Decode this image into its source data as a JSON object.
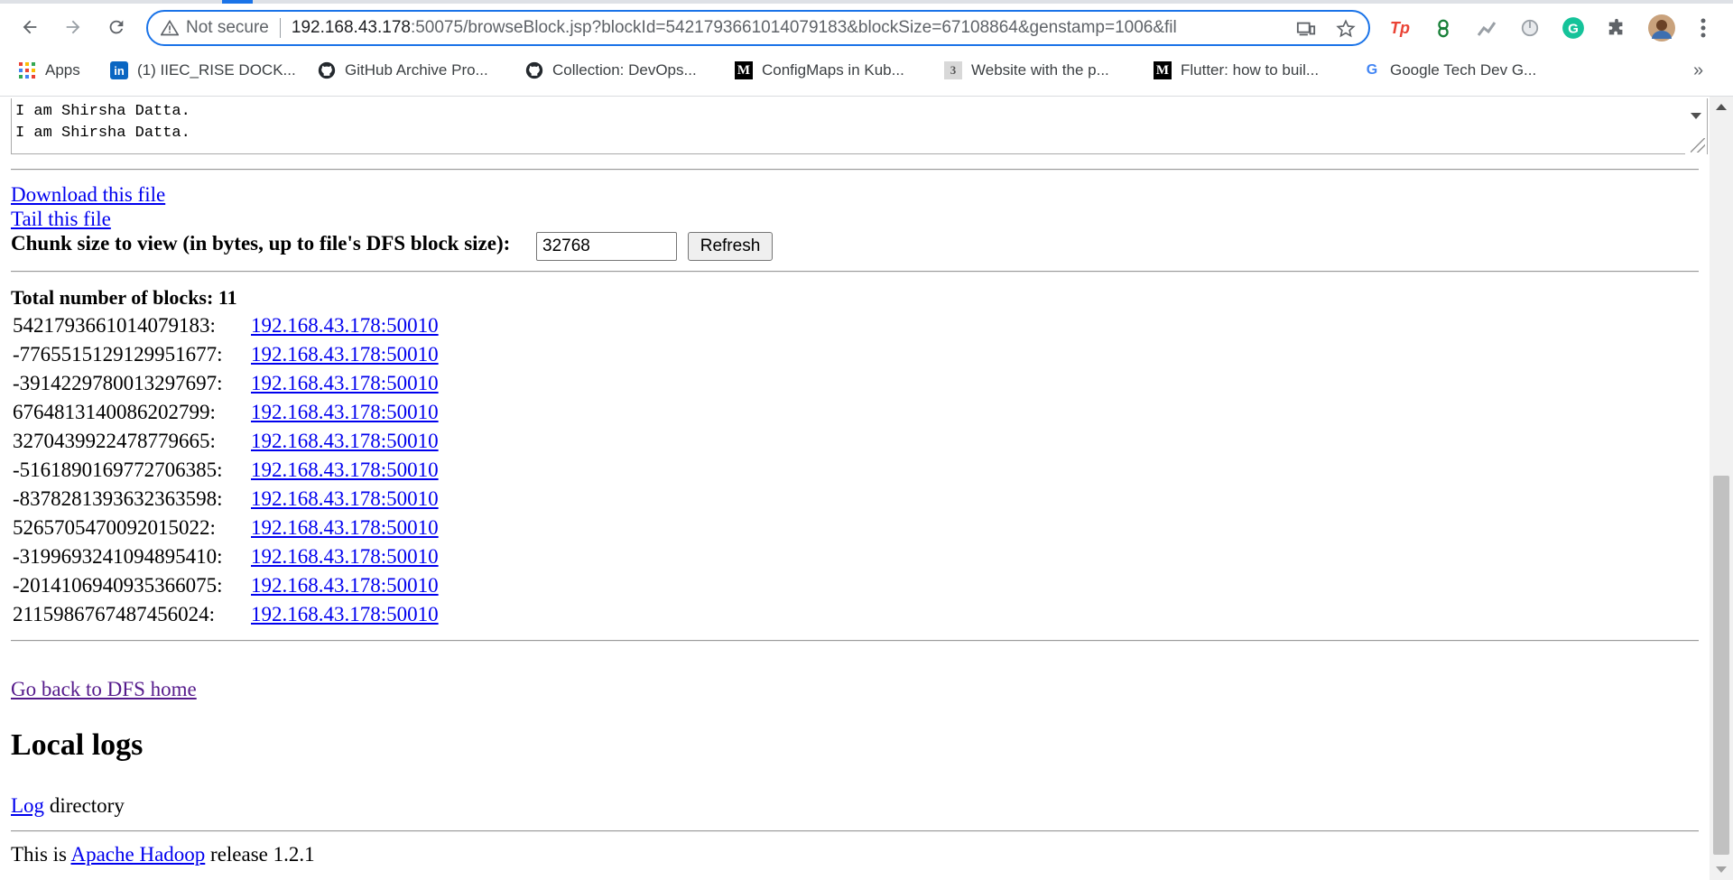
{
  "browser": {
    "omnibox": {
      "security_label": "Not secure",
      "url_host": "192.168.43.178",
      "url_rest": ":50075/browseBlock.jsp?blockId=5421793661014079183&blockSize=67108864&genstamp=1006&fil"
    },
    "bookmarks": [
      {
        "label": "Apps",
        "icon": "apps-grid-icon",
        "color": "#4285f4"
      },
      {
        "label": "(1) IIEC_RISE DOCK...",
        "icon": "linkedin-icon",
        "color": "#0a66c2"
      },
      {
        "label": "GitHub Archive Pro...",
        "icon": "github-icon",
        "color": "#24292e"
      },
      {
        "label": "Collection: DevOps...",
        "icon": "github-icon",
        "color": "#24292e"
      },
      {
        "label": "ConfigMaps in Kub...",
        "icon": "medium-icon",
        "color": "#000000"
      },
      {
        "label": "Website with the p...",
        "icon": "page-favicon-icon",
        "color": "#888888"
      },
      {
        "label": "Flutter: how to buil...",
        "icon": "medium-icon",
        "color": "#000000"
      },
      {
        "label": "Google Tech Dev G...",
        "icon": "google-icon",
        "color": "#4285f4"
      }
    ],
    "accent_color": "#1a73e8"
  },
  "page": {
    "textarea_lines": "I am Shirsha Datta.\nI am Shirsha Datta.",
    "download_link": "Download this file",
    "tail_link": "Tail this file",
    "chunk_label": "Chunk size to view (in bytes, up to file's DFS block size):",
    "chunk_value": "32768",
    "refresh_label": "Refresh",
    "total_blocks_label": "Total number of blocks: 11",
    "blocks": [
      {
        "id": "5421793661014079183:",
        "node": "192.168.43.178:50010"
      },
      {
        "id": "-7765515129129951677:",
        "node": "192.168.43.178:50010"
      },
      {
        "id": "-3914229780013297697:",
        "node": "192.168.43.178:50010"
      },
      {
        "id": "6764813140086202799:",
        "node": "192.168.43.178:50010"
      },
      {
        "id": "3270439922478779665:",
        "node": "192.168.43.178:50010"
      },
      {
        "id": "-5161890169772706385:",
        "node": "192.168.43.178:50010"
      },
      {
        "id": "-8378281393632363598:",
        "node": "192.168.43.178:50010"
      },
      {
        "id": "5265705470092015022:",
        "node": "192.168.43.178:50010"
      },
      {
        "id": "-3199693241094895410:",
        "node": "192.168.43.178:50010"
      },
      {
        "id": "-2014106940935366075:",
        "node": "192.168.43.178:50010"
      },
      {
        "id": "2115986767487456024:",
        "node": "192.168.43.178:50010"
      }
    ],
    "dfs_home_link": "Go back to DFS home",
    "local_logs_heading": "Local logs",
    "log_link": "Log",
    "log_suffix": " directory",
    "footer_prefix": "This is ",
    "footer_link": "Apache Hadoop",
    "footer_suffix": " release 1.2.1"
  }
}
